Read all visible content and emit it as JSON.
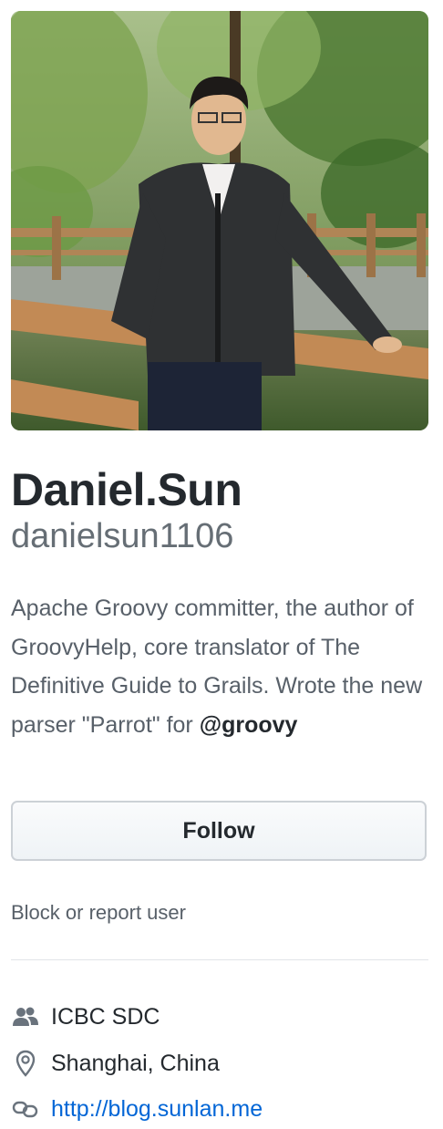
{
  "profile": {
    "fullname": "Daniel.Sun",
    "username": "danielsun1106",
    "bio_text": "Apache Groovy committer, the author of GroovyHelp, core translator of The Definitive Guide to Grails. Wrote the new parser \"Parrot\" for ",
    "bio_mention": "@groovy",
    "follow_label": "Follow",
    "block_label": "Block or report user"
  },
  "details": {
    "organization": "ICBC SDC",
    "location": "Shanghai, China",
    "website": "http://blog.sunlan.me"
  },
  "icons": {
    "organization": "people-icon",
    "location": "location-pin-icon",
    "website": "link-icon"
  },
  "colors": {
    "text": "#24292e",
    "muted": "#586069",
    "link": "#0366d6",
    "button_border": "#ccd1d6"
  }
}
